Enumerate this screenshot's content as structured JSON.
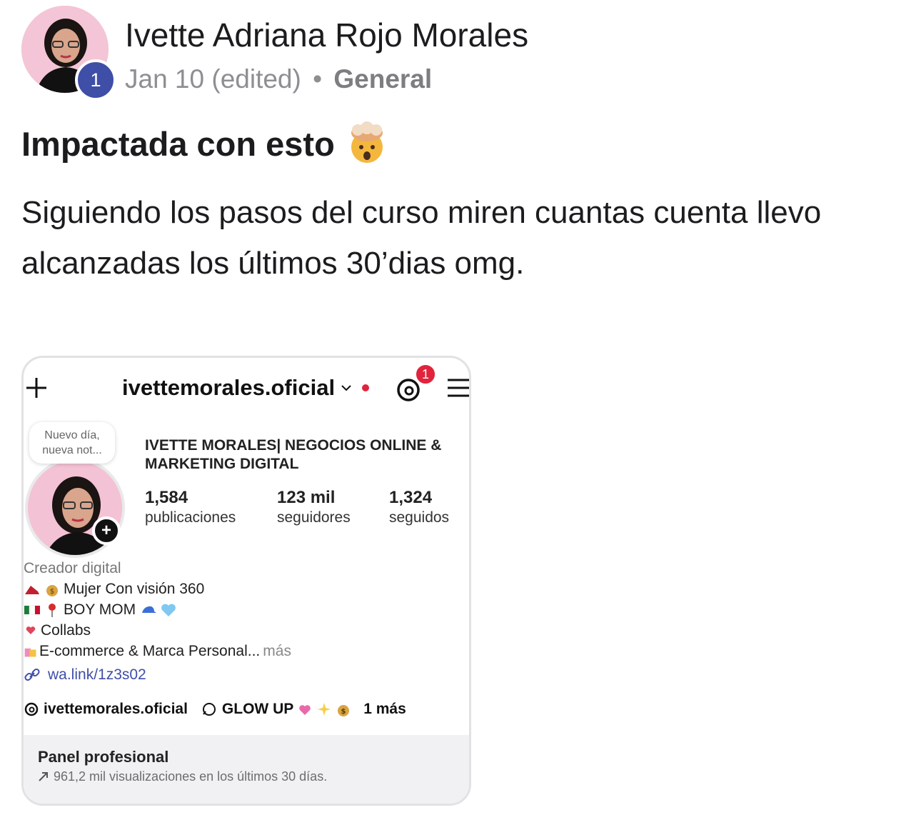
{
  "post": {
    "author_name": "Ivette Adriana Rojo Morales",
    "level": "1",
    "date": "Jan 10 (edited)",
    "separator": "•",
    "category": "General",
    "title": "Impactada con esto",
    "body": "Siguiendo los pasos del curso miren cuantas cuenta llevo alcanzadas los últimos 30’dias omg."
  },
  "instagram": {
    "username": "ivettemorales.oficial",
    "notification_count": "1",
    "note": "Nuevo día, nueva not...",
    "display_name": "IVETTE MORALES| NEGOCIOS ONLINE & MARKETING DIGITAL",
    "stats": [
      {
        "value": "1,584",
        "label": "publicaciones"
      },
      {
        "value": "123 mil",
        "label": "seguidores"
      },
      {
        "value": "1,324",
        "label": "seguidos"
      }
    ],
    "bio": {
      "category": "Creador digital",
      "line1": "Mujer Con visión 360",
      "line2": "BOY MOM",
      "line3": "Collabs",
      "line4": "E-commerce & Marca Personal...",
      "more": "más",
      "link": "wa.link/1z3s02"
    },
    "threads_handle": "ivettemorales.oficial",
    "highlight": "GLOW UP",
    "extra": "1 más",
    "panel_title": "Panel profesional",
    "panel_subtitle": "961,2 mil visualizaciones en los últimos 30 días."
  },
  "colors": {
    "level_badge": "#3f4ea6",
    "notification": "#e0243c",
    "link": "#3f4fa8"
  }
}
